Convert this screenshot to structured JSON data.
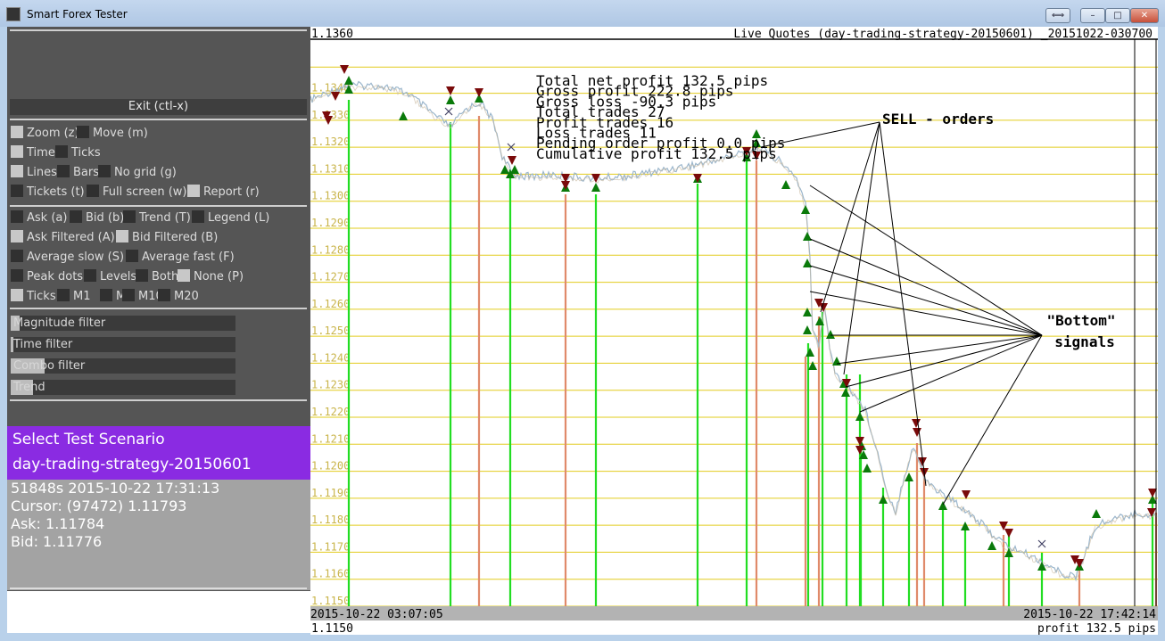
{
  "window": {
    "title": "Smart Forex Tester",
    "btn_extra": "⟺",
    "btn_min": "–",
    "btn_max": "□",
    "btn_close": "✕"
  },
  "left_panel": {
    "exit_label": "Exit (ctl-x)",
    "rows": [
      [
        {
          "label": "Zoom (z)",
          "box": "light"
        },
        {
          "label": "Move (m)",
          "box": "dark"
        }
      ],
      [
        {
          "label": "Time",
          "box": "light"
        },
        {
          "label": "Ticks",
          "box": "dark"
        }
      ],
      [
        {
          "label": "Lines",
          "box": "light"
        },
        {
          "label": "Bars",
          "box": "dark"
        },
        {
          "label": "No grid (g)",
          "box": "dark"
        }
      ],
      [
        {
          "label": "Tickets (t)",
          "box": "dark"
        },
        {
          "label": "Full screen (w)",
          "box": "dark"
        },
        {
          "label": "Report (r)",
          "box": "light"
        }
      ],
      [
        {
          "label": "Ask (a)",
          "box": "dark"
        },
        {
          "label": "Bid (b)",
          "box": "dark"
        },
        {
          "label": "Trend (T)",
          "box": "dark"
        },
        {
          "label": "Legend (L)",
          "box": "dark"
        }
      ],
      [
        {
          "label": "Ask Filtered (A)",
          "box": "light"
        },
        {
          "label": "Bid Filtered (B)",
          "box": "light"
        }
      ],
      [
        {
          "label": "Average slow (S)",
          "box": "dark"
        },
        {
          "label": "Average fast (F)",
          "box": "dark"
        }
      ],
      [
        {
          "label": "Peak dots",
          "box": "dark"
        },
        {
          "label": "Levels",
          "box": "dark"
        },
        {
          "label": "Both",
          "box": "dark"
        },
        {
          "label": "None (P)",
          "box": "light"
        }
      ],
      [
        {
          "label": "Ticks",
          "box": "light"
        },
        {
          "label": "M1",
          "box": "dark"
        },
        {
          "label": "M5",
          "box": "dark"
        },
        {
          "label": "M10",
          "box": "dark"
        },
        {
          "label": "M20",
          "box": "dark"
        }
      ]
    ],
    "filters": [
      {
        "label": "Magnitude filter",
        "level": 0.04
      },
      {
        "label": "Time filter",
        "level": 0.01
      },
      {
        "label": "Combo filter",
        "level": 0.15
      },
      {
        "label": "Trend",
        "level": 0.1
      }
    ]
  },
  "scenario": {
    "title": "Select Test Scenario",
    "name": "day-trading-strategy-20150601"
  },
  "status": {
    "line1": "51848s  2015-10-22  17:31:13",
    "line2": "Cursor:  (97472)  1.11793",
    "line3": "Ask:  1.11784",
    "line4": "Bid:  1.11776"
  },
  "chart": {
    "top_price": "1.1360",
    "header": "Live Quotes (day-trading-strategy-20150601) _20151022-030700",
    "start_time": "2015-10-22 03:07:05",
    "end_time": "2015-10-22 17:42:14",
    "bottom_price": "1.1150",
    "profit_text": "profit 132.5 pips",
    "stats": [
      "Total net profit 132.5 pips",
      "Gross profit 222.8 pips",
      "Gross loss -90.3 pips",
      "Total trades 27",
      "Profit trades 16",
      "Loss trades 11",
      "Pending order profit 0.0 pips",
      "Cumulative profit 132.5 pips"
    ],
    "annotation_sell": "SELL - orders",
    "annotation_bottom_1": "\"Bottom\"",
    "annotation_bottom_2": "signals",
    "price_levels": [
      "1.1340",
      "1.1330",
      "1.1320",
      "1.1310",
      "1.1300",
      "1.1290",
      "1.1280",
      "1.1270",
      "1.1260",
      "1.1250",
      "1.1240",
      "1.1230",
      "1.1220",
      "1.1210",
      "1.1200",
      "1.1190",
      "1.1180",
      "1.1170",
      "1.1160",
      "1.1150"
    ]
  },
  "colors": {
    "level_line": "#e2cc1e",
    "win_line": "#22dd22",
    "loss_line": "#e08a6a",
    "buy_marker": "#0a7a0a",
    "sell_marker": "#7a0a0a",
    "price_line": "#9bb6cc",
    "purple": "#8a2be2"
  }
}
